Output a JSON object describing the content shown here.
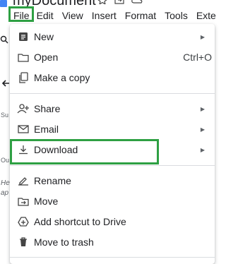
{
  "document": {
    "title": "myDocument"
  },
  "menubar": [
    "File",
    "Edit",
    "View",
    "Insert",
    "Format",
    "Tools",
    "Exte"
  ],
  "left_strip": {
    "label_su": "Su",
    "label_ou": "Ou",
    "line_he": "He",
    "line_ap": "ap"
  },
  "file_menu": {
    "new": "New",
    "open": "Open",
    "open_shortcut": "Ctrl+O",
    "make_copy": "Make a copy",
    "share": "Share",
    "email": "Email",
    "download": "Download",
    "rename": "Rename",
    "move": "Move",
    "add_shortcut": "Add shortcut to Drive",
    "move_to_trash": "Move to trash"
  },
  "colors": {
    "highlight": "#2ea043",
    "logo": "#4285f4"
  }
}
